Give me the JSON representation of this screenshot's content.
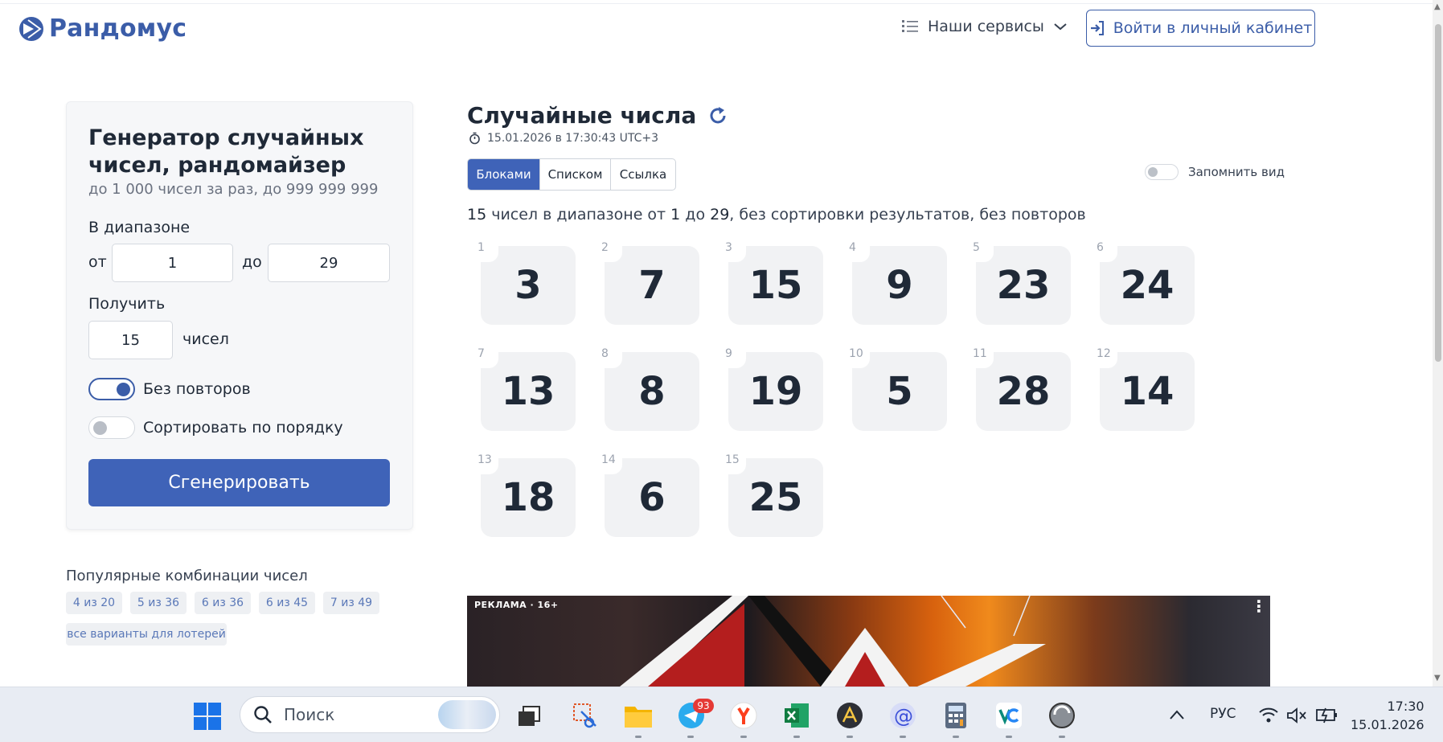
{
  "header": {
    "logo_text": "Рандомус",
    "services_label": "Наши сервисы",
    "login_label": "Войти в личный кабинет"
  },
  "form": {
    "title": "Генератор случайных чисел, рандомайзер",
    "subtitle": "до 1 000 чисел за раз, до 999 999 999",
    "range_label": "В диапазоне",
    "from_label": "от",
    "from_value": "1",
    "to_label": "до",
    "to_value": "29",
    "count_label": "Получить",
    "count_value": "15",
    "count_unit": "чисел",
    "no_repeat_label": "Без повторов",
    "no_repeat_on": true,
    "sort_label": "Сортировать по порядку",
    "sort_on": false,
    "generate_label": "Сгенерировать"
  },
  "popular": {
    "title": "Популярные комбинации чисел",
    "chips": [
      "4 из 20",
      "5 из 36",
      "6 из 36",
      "6 из 45",
      "7 из 49",
      "все варианты для лотерей"
    ]
  },
  "results": {
    "title": "Случайные числа",
    "timestamp": "15.01.2026 в 17:30:43 UTC+3",
    "tabs": [
      "Блоками",
      "Списком",
      "Ссылка"
    ],
    "active_tab": "Блоками",
    "remember_label": "Запомнить вид",
    "summary_count": "15",
    "summary_a": " чисел в диапазоне от ",
    "summary_from": "1",
    "summary_b": " до ",
    "summary_to": "29",
    "summary_c": ", без сортировки результатов, без повторов",
    "numbers": [
      3,
      7,
      15,
      9,
      23,
      24,
      13,
      8,
      19,
      5,
      28,
      14,
      18,
      6,
      25
    ]
  },
  "ad": {
    "label": "РЕКЛАМА · 16+"
  },
  "taskbar": {
    "search_placeholder": "Поиск",
    "telegram_badge": "93",
    "language": "РУС",
    "time": "17:30",
    "date": "15.01.2026"
  },
  "colors": {
    "brand": "#3b5da8",
    "button": "#3f63b8",
    "number_tile": "#f1f2f4"
  }
}
